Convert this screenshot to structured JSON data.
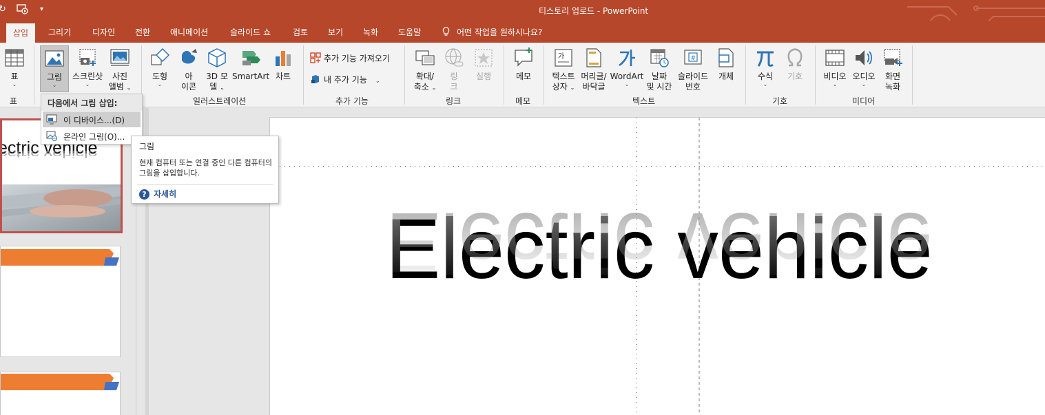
{
  "window": {
    "title": "티스토리 업로드  -  PowerPoint",
    "qat": {
      "dropdown": "▾"
    }
  },
  "tabs": [
    {
      "label": "삽입",
      "active": true
    },
    {
      "label": "그리기"
    },
    {
      "label": "디자인"
    },
    {
      "label": "전환"
    },
    {
      "label": "애니메이션"
    },
    {
      "label": "슬라이드 쇼"
    },
    {
      "label": "검토"
    },
    {
      "label": "보기"
    },
    {
      "label": "녹화"
    },
    {
      "label": "도움말"
    }
  ],
  "tell_me": "어떤 작업을 원하시나요?",
  "ribbon": {
    "table": {
      "label": "표",
      "group": "표"
    },
    "picture": {
      "label": "그림"
    },
    "screenshot": {
      "label": "스크린샷"
    },
    "photo_album": {
      "line1": "사진",
      "line2": "앨범"
    },
    "shapes": {
      "label": "도형"
    },
    "icons": {
      "line1": "아",
      "line2": "이콘"
    },
    "model3d": {
      "line1": "3D 모",
      "line2": "델"
    },
    "smartart": {
      "label": "SmartArt"
    },
    "chart": {
      "label": "차트"
    },
    "illustrations_group": "일러스트레이션",
    "get_addins": "추가 기능 가져오기",
    "my_addins": "내 추가 기능",
    "addins_group": "추가 기능",
    "zoom": {
      "line1": "확대/",
      "line2": "축소"
    },
    "link": {
      "line1": "링",
      "line2": "크"
    },
    "action": {
      "label": "실행"
    },
    "links_group": "링크",
    "comment": {
      "label": "메모",
      "group": "메모"
    },
    "textbox": {
      "line1": "텍스트",
      "line2": "상자"
    },
    "header_footer": {
      "line1": "머리글/",
      "line2": "바닥글"
    },
    "wordart": {
      "label": "WordArt"
    },
    "date_time": {
      "line1": "날짜",
      "line2": "및 시간"
    },
    "slide_number": {
      "line1": "슬라이드",
      "line2": "번호"
    },
    "object": {
      "label": "개체"
    },
    "text_group": "텍스트",
    "equation": {
      "label": "수식"
    },
    "symbol": {
      "label": "기호"
    },
    "symbols_group": "기호",
    "video": {
      "label": "비디오"
    },
    "audio": {
      "label": "오디오"
    },
    "screen_recording": {
      "line1": "화면",
      "line2": "녹화"
    },
    "media_group": "미디어"
  },
  "dropdown": {
    "header": "다음에서 그림 삽입:",
    "items": [
      {
        "label": "이 디바이스...(D)",
        "highlighted": true
      },
      {
        "label": "온라인 그림(O)..."
      }
    ]
  },
  "tooltip": {
    "title": "그림",
    "description": "현재 컴퓨터 또는 연결 중인 다른 컴퓨터의 그림을 삽입합니다.",
    "more": "자세히"
  },
  "slides": {
    "thumb1_text": "ectric vehicle"
  },
  "main_slide": {
    "title": "Electric vehicle"
  },
  "colors": {
    "accent": "#b7472a",
    "thumb_banner": "#ed7d31",
    "thumb_banner_tip": "#4472c4"
  }
}
